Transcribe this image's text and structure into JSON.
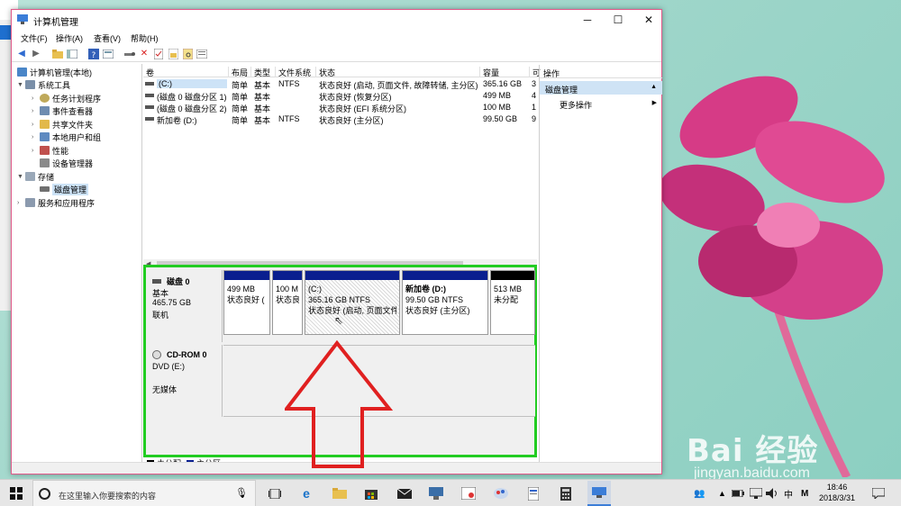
{
  "window": {
    "title": "计算机管理",
    "buttons": {
      "minimize": "─",
      "maximize": "☐",
      "close": "✕"
    }
  },
  "menu": [
    "文件(F)",
    "操作(A)",
    "查看(V)",
    "帮助(H)"
  ],
  "tree": {
    "root": "计算机管理(本地)",
    "system_tools": "系统工具",
    "task_scheduler": "任务计划程序",
    "event_viewer": "事件查看器",
    "shared_folders": "共享文件夹",
    "local_users": "本地用户和组",
    "performance": "性能",
    "device_manager": "设备管理器",
    "storage": "存储",
    "disk_management": "磁盘管理",
    "services_apps": "服务和应用程序"
  },
  "volume_list": {
    "headers": [
      "卷",
      "布局",
      "类型",
      "文件系统",
      "状态",
      "容量",
      "可"
    ],
    "rows": [
      [
        "(C:)",
        "简单",
        "基本",
        "NTFS",
        "状态良好 (启动, 页面文件, 故障转储, 主分区)",
        "365.16 GB",
        "3"
      ],
      [
        "(磁盘 0 磁盘分区 1)",
        "简单",
        "基本",
        "",
        "状态良好 (恢复分区)",
        "499 MB",
        "4"
      ],
      [
        "(磁盘 0 磁盘分区 2)",
        "简单",
        "基本",
        "",
        "状态良好 (EFI 系统分区)",
        "100 MB",
        "1"
      ],
      [
        "新加卷 (D:)",
        "简单",
        "基本",
        "NTFS",
        "状态良好 (主分区)",
        "99.50 GB",
        "9"
      ]
    ]
  },
  "disk0": {
    "name": "磁盘 0",
    "type": "基本",
    "size": "465.75 GB",
    "status": "联机",
    "partitions": [
      {
        "label": "",
        "size": "499 MB",
        "status": "状态良好 ("
      },
      {
        "label": "",
        "size": "100 M",
        "status": "状态良"
      },
      {
        "label": "(C:)",
        "size": "365.16 GB NTFS",
        "status": "状态良好 (启动, 页面文件"
      },
      {
        "label": "新加卷  (D:)",
        "size": "99.50 GB NTFS",
        "status": "状态良好 (主分区)"
      },
      {
        "label": "",
        "size": "513 MB",
        "status": "未分配"
      }
    ]
  },
  "cdrom": {
    "name": "CD-ROM 0",
    "drive": "DVD (E:)",
    "status": "无媒体"
  },
  "legend": {
    "unallocated": "未分配",
    "primary": "主分区"
  },
  "actions": {
    "header": "操作",
    "section": "磁盘管理",
    "more": "更多操作"
  },
  "taskbar": {
    "search_placeholder": "在这里输入你要搜索的内容",
    "ime_lang": "中",
    "ime_mode": "M",
    "time": "18:46",
    "date": "2018/3/31"
  },
  "watermark": {
    "big": "Bai 经验",
    "small": "jingyan.baidu.com"
  },
  "colors": {
    "highlight_border": "#22cc22",
    "primary_partition": "#0a1f8f",
    "unallocated": "#000000",
    "arrow": "#e02020"
  }
}
